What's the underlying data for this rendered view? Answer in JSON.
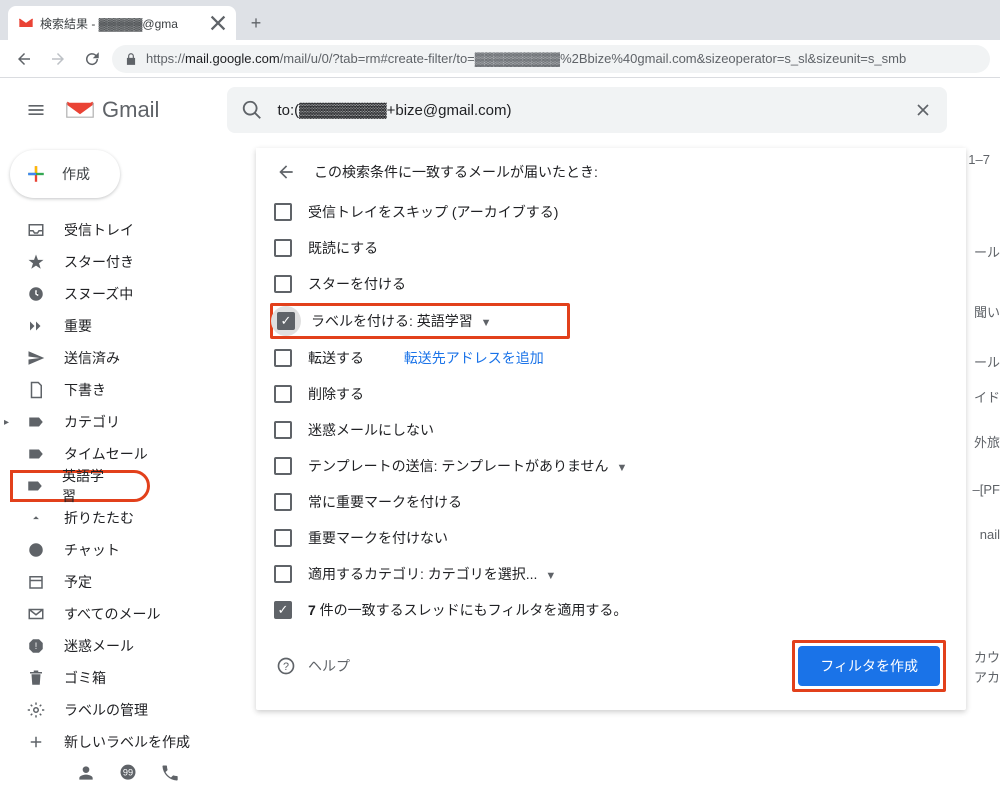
{
  "browser": {
    "tab_title": "検索結果 - ▓▓▓▓▓@gma",
    "url_prefix": "https://",
    "url_domain": "mail.google.com",
    "url_path": "/mail/u/0/?tab=rm#create-filter/to=▓▓▓▓▓▓▓▓▓%2Bbize%40gmail.com&sizeoperator=s_sl&sizeunit=s_smb"
  },
  "gmail": {
    "product": "Gmail",
    "search_value": "to:(▓▓▓▓▓▓▓▓+bize@gmail.com)",
    "compose": "作成"
  },
  "sidebar": {
    "items": [
      {
        "icon": "inbox",
        "label": "受信トレイ"
      },
      {
        "icon": "star",
        "label": "スター付き"
      },
      {
        "icon": "clock",
        "label": "スヌーズ中"
      },
      {
        "icon": "chevrons",
        "label": "重要"
      },
      {
        "icon": "send",
        "label": "送信済み"
      },
      {
        "icon": "file",
        "label": "下書き"
      },
      {
        "icon": "label",
        "label": "カテゴリ",
        "arrow": true
      },
      {
        "icon": "label",
        "label": "タイムセール"
      },
      {
        "icon": "label",
        "label": "英語学習",
        "highlight": true
      },
      {
        "icon": "caret",
        "label": "折りたたむ"
      },
      {
        "icon": "chat",
        "label": "チャット"
      },
      {
        "icon": "calendar",
        "label": "予定"
      },
      {
        "icon": "mail",
        "label": "すべてのメール"
      },
      {
        "icon": "spam",
        "label": "迷惑メール"
      },
      {
        "icon": "trash",
        "label": "ゴミ箱"
      },
      {
        "icon": "gear",
        "label": "ラベルの管理"
      },
      {
        "icon": "plus",
        "label": "新しいラベルを作成"
      }
    ]
  },
  "content": {
    "page_count": "1–7",
    "ghosts": [
      "ール",
      "聞い",
      "ール",
      "イド",
      "外旅",
      "–[PF",
      "nail",
      "カウ",
      "アカ"
    ]
  },
  "filter": {
    "header": "この検索条件に一致するメールが届いたとき:",
    "options": {
      "skip_inbox": "受信トレイをスキップ (アーカイブする)",
      "mark_read": "既読にする",
      "star": "スターを付ける",
      "apply_label_prefix": "ラベルを付ける:",
      "apply_label_value": "英語学習",
      "forward": "転送する",
      "forward_link": "転送先アドレスを追加",
      "delete": "削除する",
      "no_spam": "迷惑メールにしない",
      "template_prefix": "テンプレートの送信:",
      "template_value": "テンプレートがありません",
      "always_important": "常に重要マークを付ける",
      "never_important": "重要マークを付けない",
      "category_prefix": "適用するカテゴリ:",
      "category_value": "カテゴリを選択...",
      "also_apply_prefix": "7",
      "also_apply_rest": " 件の一致するスレッドにもフィルタを適用する。"
    },
    "help": "ヘルプ",
    "create": "フィルタを作成"
  }
}
